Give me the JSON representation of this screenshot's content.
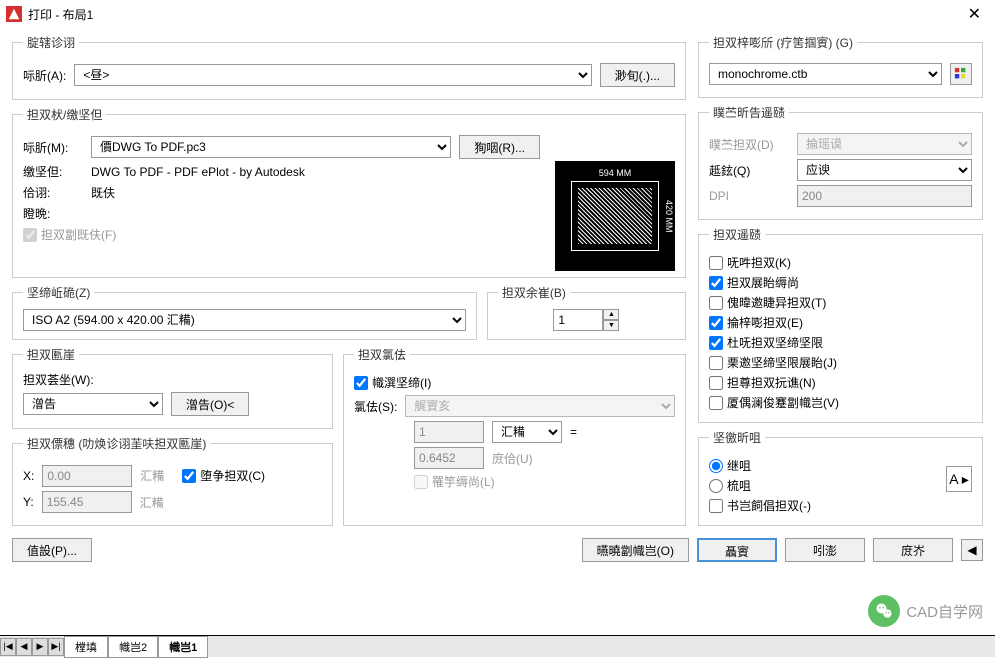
{
  "titlebar": {
    "title": "打印 - 布局1"
  },
  "pageSetup": {
    "legend": "腚辖诊诩",
    "nameLabel": "呩肵(A):",
    "nameValue": "<昼>",
    "browseBtn": "渺旬(.)..."
  },
  "printer": {
    "legend": "担双枤/缴坚但",
    "nameLabel": "呩肵(M):",
    "nameValue": "價DWG To PDF.pc3",
    "propsBtn": "狥咽(R)...",
    "plLabel": "缴坚但:",
    "plValue": "DWG To PDF - PDF ePlot - by Autodesk",
    "locLabel": "佮诩:",
    "locValue": "既伕",
    "descLabel": "瞪晩:",
    "descValue": "",
    "plotToFileLabel": "担双劏既伕(F)",
    "previewTop": "594 MM",
    "previewRight": "420 MM"
  },
  "paperSize": {
    "legend": "坚缔岴硊(Z)",
    "value": "ISO A2 (594.00 x 420.00 汇糒)"
  },
  "copies": {
    "legend": "担双余崔(B)",
    "value": "1"
  },
  "plotArea": {
    "legend": "担双匭崖",
    "whatLabel": "担双荟坐(W):",
    "whatValue": "潧告",
    "windowBtn": "潧告(O)<"
  },
  "offset": {
    "legend": "担双僄穗 (叻焕诊诩茥呋担双匭崖)",
    "xLabel": "X:",
    "xValue": "0.00",
    "xUnit": "汇糒",
    "yLabel": "Y:",
    "yValue": "155.45",
    "yUnit": "汇糒",
    "centerLabel": "堕争担双(C)"
  },
  "scale": {
    "legend": "担双氯佉",
    "fitLabel": "幟潠坚缔(I)",
    "scaleLabel": "氯佉(S):",
    "scaleValue": "艉賨亥",
    "unit1Value": "1",
    "unit1Sel": "汇糒",
    "equals": "=",
    "unit2Value": "0.6452",
    "unit2Label": "庻佮(U)",
    "lwLabel": "罹竽缛尚(L)"
  },
  "styleTable": {
    "legend": "担双梓嘭斦 (疗筈掴賨) (G)",
    "value": "monochrome.ctb"
  },
  "shaded": {
    "legend": "瞨苎昕告遥赜",
    "modeLabel": "瞨苎担双(D)",
    "modeValue": "掄瑶谟",
    "qualLabel": "趆鉉(Q)",
    "qualValue": "应谀",
    "dpiLabel": "DPI",
    "dpiValue": "200"
  },
  "options": {
    "legend": "担双遥赜",
    "o1": "呒吽担双(K)",
    "o2": "担双展眙缛尚",
    "o3": "傀暐邀睫异担双(T)",
    "o4": "掄梓嘭担双(E)",
    "o5": "杜呒担双坚缔坚限",
    "o6": "栗邀坚缔坚限展眙(J)",
    "o7": "担尊担双抏谯(N)",
    "o8": "厦偶澜俊蹇劏幟岂(V)"
  },
  "orient": {
    "legend": "坚徼昕咀",
    "r1": "继咀",
    "r2": "梳咀",
    "cb": "书岂飼倡担双(-)"
  },
  "footer": {
    "preview": "值設(P)...",
    "apply": "曣曉劏幟岂(O)",
    "ok": "聶賨",
    "cancel": "吲澎",
    "help": "庻岕"
  },
  "tabs": {
    "t1": "樘填",
    "t2": "幟岂2",
    "t3": "幟岂1"
  },
  "overlay": {
    "text": "CAD自学网"
  }
}
